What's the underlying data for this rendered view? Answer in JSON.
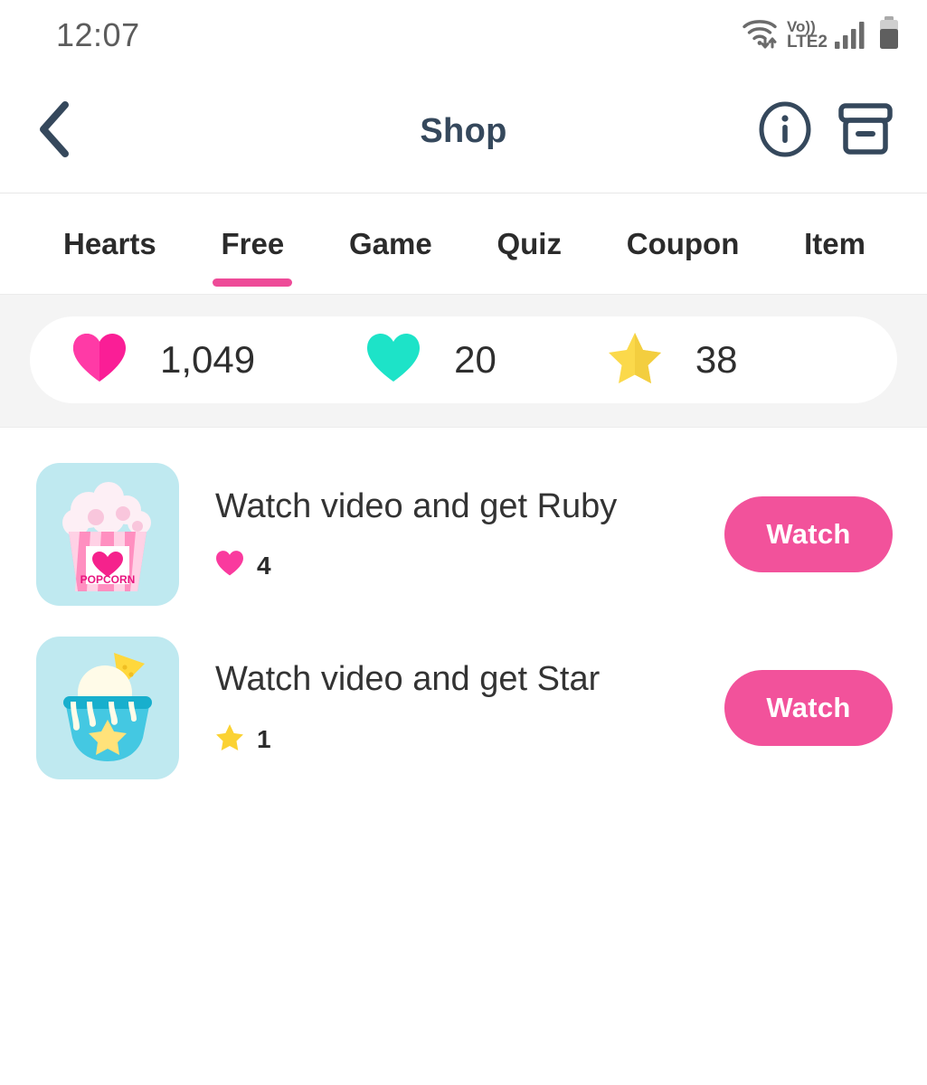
{
  "status_bar": {
    "time": "12:07",
    "wifi_icon": "wifi-icon",
    "volte_label_top": "Vo))",
    "volte_label_bottom": "LTE2",
    "signal_icon": "signal-bars-icon",
    "battery_icon": "battery-icon"
  },
  "header": {
    "back_icon": "chevron-left-icon",
    "title": "Shop",
    "info_icon": "info-circle-icon",
    "archive_icon": "archive-box-icon"
  },
  "tabs": {
    "items": [
      {
        "label": "Hearts",
        "active": false
      },
      {
        "label": "Free",
        "active": true
      },
      {
        "label": "Game",
        "active": false
      },
      {
        "label": "Quiz",
        "active": false
      },
      {
        "label": "Coupon",
        "active": false
      },
      {
        "label": "Item",
        "active": false
      }
    ],
    "active_index": 1
  },
  "currency_bar": {
    "items": [
      {
        "icon": "pink-heart-icon",
        "value": "1,049"
      },
      {
        "icon": "teal-heart-icon",
        "value": "20"
      },
      {
        "icon": "yellow-star-icon",
        "value": "38"
      }
    ]
  },
  "list": {
    "items": [
      {
        "thumb_icon": "popcorn-icon",
        "thumb_caption": "POPCORN",
        "title": "Watch video and get Ruby",
        "reward_icon": "pink-heart-icon",
        "reward_amount": "4",
        "action_label": "Watch"
      },
      {
        "thumb_icon": "ice-cream-bowl-icon",
        "title": "Watch video and get Star",
        "reward_icon": "yellow-star-icon",
        "reward_amount": "1",
        "action_label": "Watch"
      }
    ]
  },
  "colors": {
    "accent_pink": "#F2529B",
    "tab_underline": "#EE4B98",
    "heart_pink": "#FA1E96",
    "heart_teal": "#1DE3C8",
    "star_yellow": "#FBD94B",
    "header_text": "#35485C",
    "band_bg": "#F4F4F4",
    "thumb_bg": "#BFE9F0"
  }
}
